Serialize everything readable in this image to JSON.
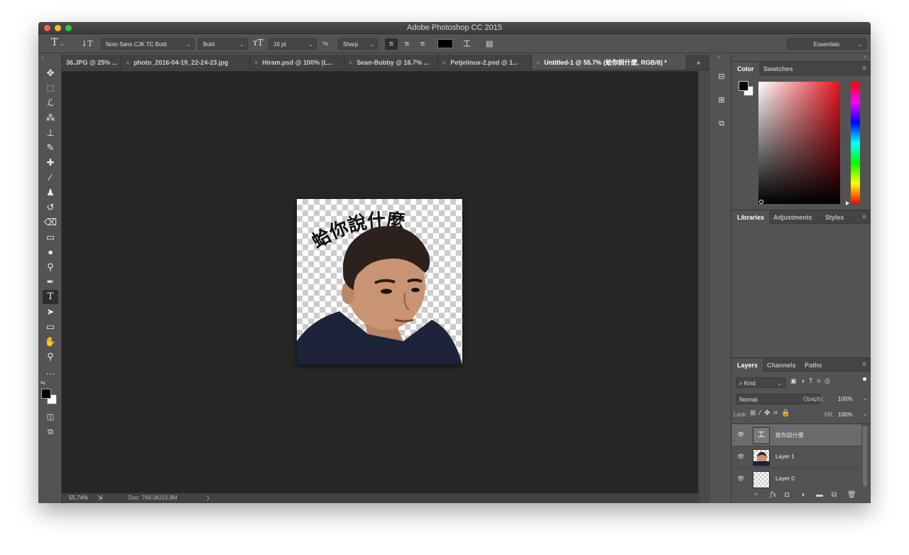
{
  "window": {
    "title": "Adobe Photoshop CC 2015"
  },
  "options_bar": {
    "tool_icon": "type-tool-icon",
    "orientation_icon": "text-orientation-icon",
    "font_family": "Noto Sans CJK TC Bold",
    "font_style": "Bold",
    "font_size": "16 pt",
    "aa_label": "ªa",
    "antialias": "Sharp",
    "text_color": "#000000",
    "workspace": "Essentials"
  },
  "tabs": [
    {
      "label": "36.JPG @ 25% ...",
      "closable": false
    },
    {
      "label": "photo_2016-04-19_22-24-23.jpg",
      "closable": true
    },
    {
      "label": "Hiram.psd @ 100% (L...",
      "closable": true
    },
    {
      "label": "Sean-Bobby @ 16.7% ...",
      "closable": true
    },
    {
      "label": "Petjelinux-2.psd @ 1...",
      "closable": true
    },
    {
      "label": "Untitled-1 @ 55.7% (蛤你說什麼, RGB/8) *",
      "closable": true,
      "active": true
    }
  ],
  "tab_overflow": "»",
  "tools": [
    "move-tool-icon",
    "marquee-tool-icon",
    "lasso-tool-icon",
    "quick-selection-tool-icon",
    "crop-tool-icon",
    "eyedropper-tool-icon",
    "healing-brush-tool-icon",
    "brush-tool-icon",
    "clone-stamp-tool-icon",
    "history-brush-tool-icon",
    "eraser-tool-icon",
    "gradient-tool-icon",
    "blur-tool-icon",
    "dodge-tool-icon",
    "pen-tool-icon",
    "type-tool-icon",
    "path-selection-tool-icon",
    "rectangle-tool-icon",
    "hand-tool-icon",
    "zoom-tool-icon",
    "more-tools-icon"
  ],
  "canvas": {
    "text": "蛤你說什麼"
  },
  "status": {
    "zoom": "55.74%",
    "doc": "Doc: 768.0K/23.9M",
    "arrow": "〉"
  },
  "panels": {
    "color": {
      "tabs": [
        "Color",
        "Swatches"
      ],
      "foreground": "#000000",
      "background": "#ffffff",
      "hue": "#ff0000"
    },
    "libraries": {
      "tabs": [
        "Libraries",
        "Adjustments",
        "Styles"
      ]
    },
    "layers": {
      "tabs": [
        "Layers",
        "Channels",
        "Paths"
      ],
      "filter": "Kind",
      "blend_mode": "Normal",
      "opacity_label": "Opacity:",
      "opacity": "100%",
      "lock_label": "Lock:",
      "fill_label": "Fill:",
      "fill": "100%",
      "items": [
        {
          "name": "蛤你說什麼",
          "type": "text",
          "selected": true
        },
        {
          "name": "Layer 1",
          "type": "image",
          "selected": false
        },
        {
          "name": "Layer 0",
          "type": "transparent",
          "selected": false
        }
      ]
    }
  }
}
